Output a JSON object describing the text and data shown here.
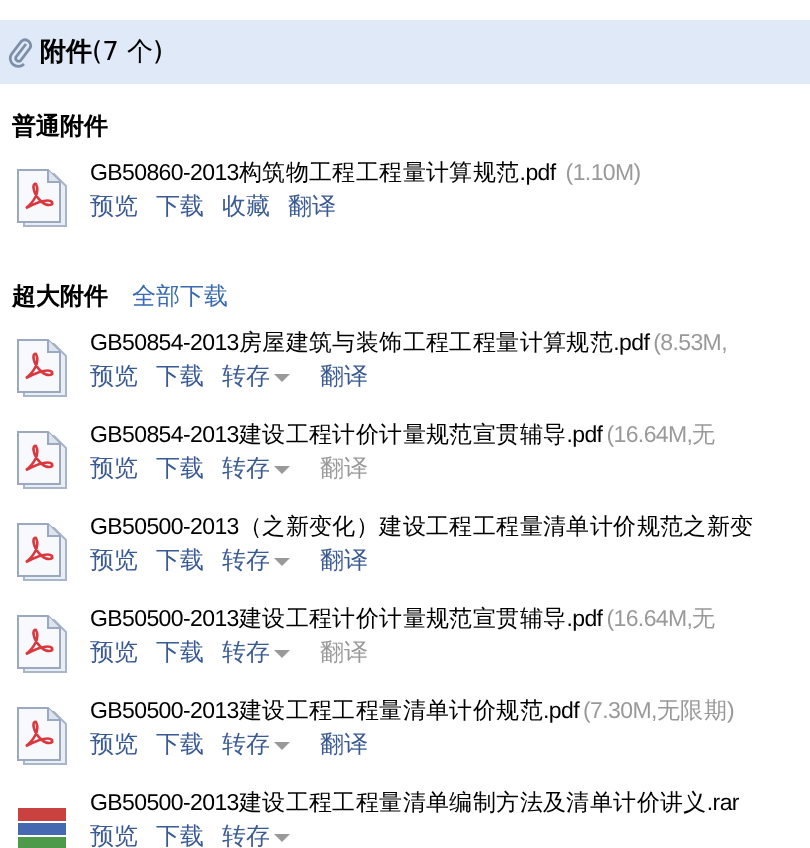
{
  "header": {
    "title": "附件",
    "count": "(7 个)"
  },
  "sections": [
    {
      "title": "普通附件",
      "items": [
        {
          "kind": "pdf",
          "name": "GB50860-2013构筑物工程工程量计算规范.pdf",
          "size": "(1.10M)",
          "actions": [
            {
              "kind": "link",
              "label": "预览",
              "disabled": false
            },
            {
              "kind": "link",
              "label": "下载",
              "disabled": false
            },
            {
              "kind": "link",
              "label": "收藏",
              "disabled": false
            },
            {
              "kind": "link",
              "label": "翻译",
              "disabled": false
            }
          ]
        }
      ]
    },
    {
      "title": "超大附件",
      "links": [
        "全部下载"
      ],
      "items": [
        {
          "kind": "pdf",
          "name": "GB50854-2013房屋建筑与装饰工程工程量计算规范.pdf",
          "size": "(8.53M,",
          "actions": [
            {
              "kind": "link",
              "label": "预览",
              "disabled": false
            },
            {
              "kind": "link",
              "label": "下载",
              "disabled": false
            },
            {
              "kind": "menu",
              "label": "转存",
              "disabled": false
            },
            {
              "kind": "link",
              "label": "翻译",
              "disabled": false
            }
          ]
        },
        {
          "kind": "pdf",
          "name": "GB50854-2013建设工程计价计量规范宣贯辅导.pdf",
          "size": "(16.64M,无",
          "actions": [
            {
              "kind": "link",
              "label": "预览",
              "disabled": false
            },
            {
              "kind": "link",
              "label": "下载",
              "disabled": false
            },
            {
              "kind": "menu",
              "label": "转存",
              "disabled": false
            },
            {
              "kind": "link",
              "label": "翻译",
              "disabled": true
            }
          ]
        },
        {
          "kind": "pdf",
          "name": "GB50500-2013（之新变化）建设工程工程量清单计价规范之新变",
          "actions": [
            {
              "kind": "link",
              "label": "预览",
              "disabled": false
            },
            {
              "kind": "link",
              "label": "下载",
              "disabled": false
            },
            {
              "kind": "menu",
              "label": "转存",
              "disabled": false
            },
            {
              "kind": "link",
              "label": "翻译",
              "disabled": false
            }
          ]
        },
        {
          "kind": "pdf",
          "name": "GB50500-2013建设工程计价计量规范宣贯辅导.pdf",
          "size": "(16.64M,无",
          "actions": [
            {
              "kind": "link",
              "label": "预览",
              "disabled": false
            },
            {
              "kind": "link",
              "label": "下载",
              "disabled": false
            },
            {
              "kind": "menu",
              "label": "转存",
              "disabled": false
            },
            {
              "kind": "link",
              "label": "翻译",
              "disabled": true
            }
          ]
        },
        {
          "kind": "pdf",
          "name": "GB50500-2013建设工程工程量清单计价规范.pdf",
          "size": "(7.30M,无限期)",
          "actions": [
            {
              "kind": "link",
              "label": "预览",
              "disabled": false
            },
            {
              "kind": "link",
              "label": "下载",
              "disabled": false
            },
            {
              "kind": "menu",
              "label": "转存",
              "disabled": false
            },
            {
              "kind": "link",
              "label": "翻译",
              "disabled": false
            }
          ]
        },
        {
          "kind": "rar",
          "name": "GB50500-2013建设工程工程量清单编制方法及清单计价讲义.rar",
          "actions": [
            {
              "kind": "link",
              "label": "预览",
              "disabled": false
            },
            {
              "kind": "link",
              "label": "下载",
              "disabled": false
            },
            {
              "kind": "menu",
              "label": "转存",
              "disabled": false
            }
          ]
        }
      ]
    }
  ]
}
